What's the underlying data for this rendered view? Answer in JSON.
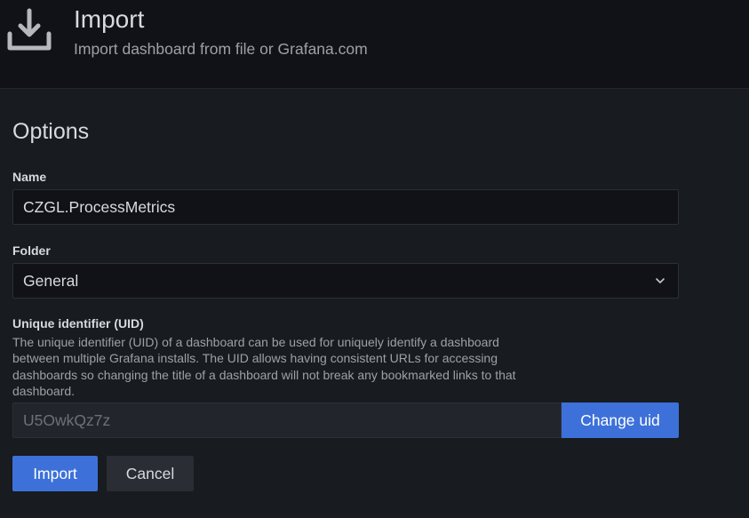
{
  "header": {
    "icon": "download-icon",
    "title": "Import",
    "subtitle": "Import dashboard from file or Grafana.com"
  },
  "options": {
    "title": "Options",
    "name": {
      "label": "Name",
      "value": "CZGL.ProcessMetrics"
    },
    "folder": {
      "label": "Folder",
      "value": "General",
      "icon": "chevron-down-icon"
    },
    "uid": {
      "label": "Unique identifier (UID)",
      "description": "The unique identifier (UID) of a dashboard can be used for uniquely identify a dashboard between multiple Grafana installs. The UID allows having consistent URLs for accessing dashboards so changing the title of a dashboard will not break any bookmarked links to that dashboard.",
      "value": "U5OwkQz7z",
      "change_button": "Change uid"
    }
  },
  "actions": {
    "import_label": "Import",
    "cancel_label": "Cancel"
  },
  "colors": {
    "page_bg": "#181b1f",
    "header_bg": "#111217",
    "primary": "#3d71d9",
    "secondary": "#2a2d33"
  }
}
